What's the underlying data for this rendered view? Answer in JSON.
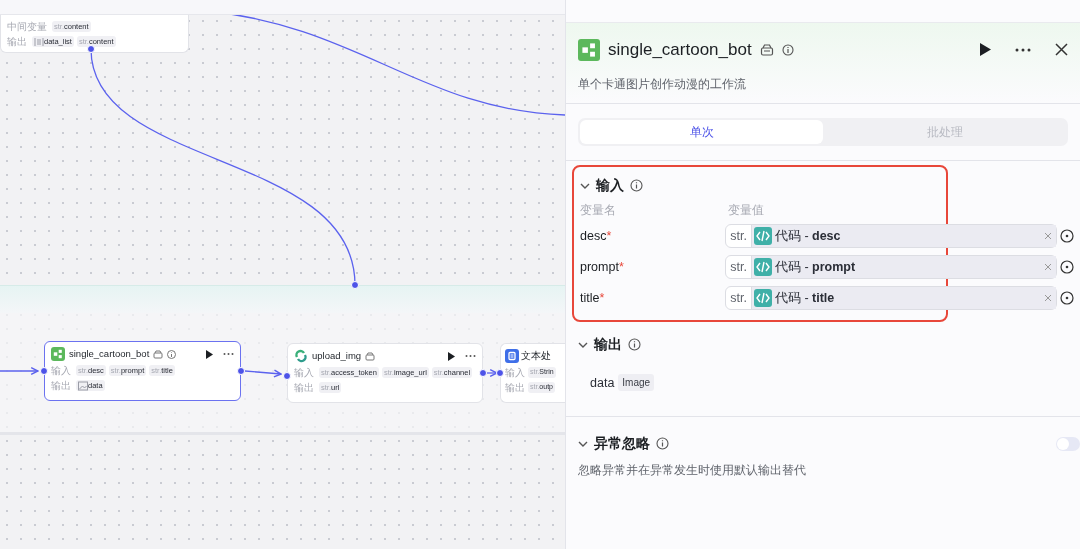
{
  "canvas": {
    "nodes": [
      {
        "kind": "partial",
        "selected": false,
        "rows": [
          {
            "label": "中间变量",
            "params": [
              {
                "type_label": "str.",
                "name": "content"
              }
            ]
          },
          {
            "label": "输出",
            "params": [
              {
                "kind": "list",
                "name": "data_list"
              },
              {
                "type_label": "str.",
                "name": "content"
              }
            ]
          }
        ]
      },
      {
        "kind": "workflow",
        "title": "single_cartoon_bot",
        "selected": true,
        "rows": [
          {
            "label": "输入",
            "params": [
              {
                "type_label": "str.",
                "name": "desc"
              },
              {
                "type_label": "str.",
                "name": "prompt"
              },
              {
                "type_label": "str.",
                "name": "title"
              }
            ]
          },
          {
            "label": "输出",
            "params": [
              {
                "kind": "image",
                "name": "data"
              }
            ]
          }
        ]
      },
      {
        "kind": "plugin",
        "title": "upload_img",
        "selected": false,
        "rows": [
          {
            "label": "输入",
            "params": [
              {
                "type_label": "str.",
                "name": "access_token"
              },
              {
                "type_label": "str.",
                "name": "image_url"
              },
              {
                "type_label": "str.",
                "name": "channel"
              }
            ]
          },
          {
            "label": "输出",
            "params": [
              {
                "type_label": "str.",
                "name": "url"
              }
            ]
          }
        ]
      },
      {
        "kind": "cut",
        "title": "文本处",
        "selected": false,
        "rows": [
          {
            "label": "输入",
            "params": [
              {
                "type_label": "str.",
                "name": "Strin"
              }
            ]
          },
          {
            "label": "输出",
            "params": [
              {
                "type_label": "str.",
                "name": "outp"
              }
            ]
          }
        ]
      }
    ]
  },
  "panel": {
    "title": "single_cartoon_bot",
    "description": "单个卡通图片创作动漫的工作流",
    "tabs": [
      {
        "label": "单次",
        "selected": true
      },
      {
        "label": "批处理",
        "selected": false
      }
    ],
    "input_section": {
      "title": "输入",
      "expanded": true,
      "highlighted": true,
      "col_name": "变量名",
      "col_value": "变量值",
      "rows": [
        {
          "name": "desc",
          "required_mark": "*",
          "type_label": "str.",
          "value": "代码 - **desc**"
        },
        {
          "name": "prompt",
          "required_mark": "*",
          "type_label": "str.",
          "value": "代码 - **prompt**"
        },
        {
          "name": "title",
          "required_mark": "*",
          "type_label": "str.",
          "value": "代码 - **title**"
        }
      ]
    },
    "output_section": {
      "title": "输出",
      "expanded": true,
      "items": [
        {
          "name": "data",
          "type": "Image"
        }
      ]
    },
    "exception_section": {
      "title": "异常忽略",
      "expanded": true,
      "on": false,
      "description": "忽略异常并在异常发生时使用默认输出替代"
    }
  }
}
